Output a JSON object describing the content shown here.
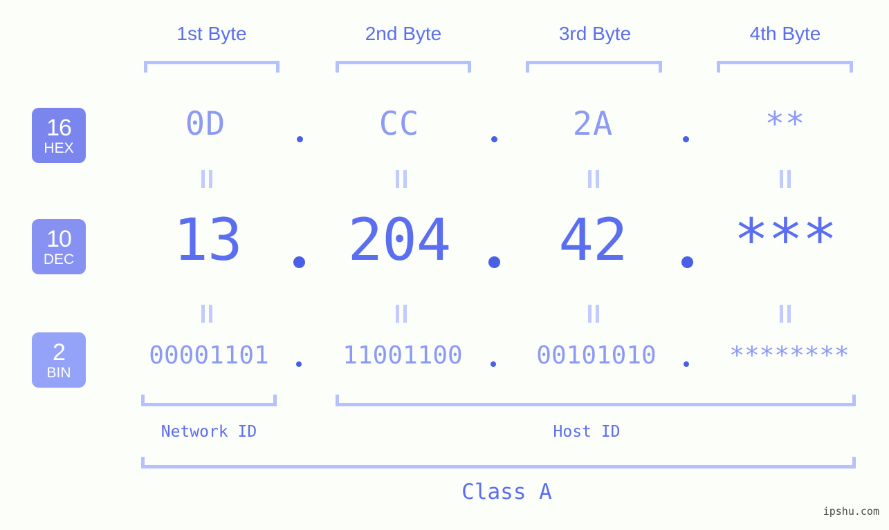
{
  "background_color": "#fcfefa",
  "accent": {
    "primary": "#5b6ef0",
    "light": "#8c9af5",
    "bracket": "#b6c0fd",
    "eq": "#c2caff",
    "dot": "#4a5fe8",
    "badge_hex": "#7a86ee",
    "badge_dec": "#8691f2",
    "badge_bin": "#94a3f7",
    "watermark": "#4a4a4a"
  },
  "byte_headers": [
    {
      "label": "1st Byte"
    },
    {
      "label": "2nd Byte"
    },
    {
      "label": "3rd Byte"
    },
    {
      "label": "4th Byte"
    }
  ],
  "bases": [
    {
      "number": "16",
      "name": "HEX"
    },
    {
      "number": "10",
      "name": "DEC"
    },
    {
      "number": "2",
      "name": "BIN"
    }
  ],
  "rows": {
    "hex": {
      "base": "16",
      "name": "HEX",
      "bytes": [
        "0D",
        "CC",
        "2A",
        "**"
      ]
    },
    "dec": {
      "base": "10",
      "name": "DEC",
      "bytes": [
        "13",
        "204",
        "42",
        "***"
      ]
    },
    "bin": {
      "base": "2",
      "name": "BIN",
      "bytes": [
        "00001101",
        "11001100",
        "00101010",
        "********"
      ]
    }
  },
  "separator": ".",
  "equality_mark": "=",
  "id_labels": {
    "network": "Network ID",
    "host": "Host ID"
  },
  "class_label": "Class A",
  "watermark": "ipshu.com"
}
